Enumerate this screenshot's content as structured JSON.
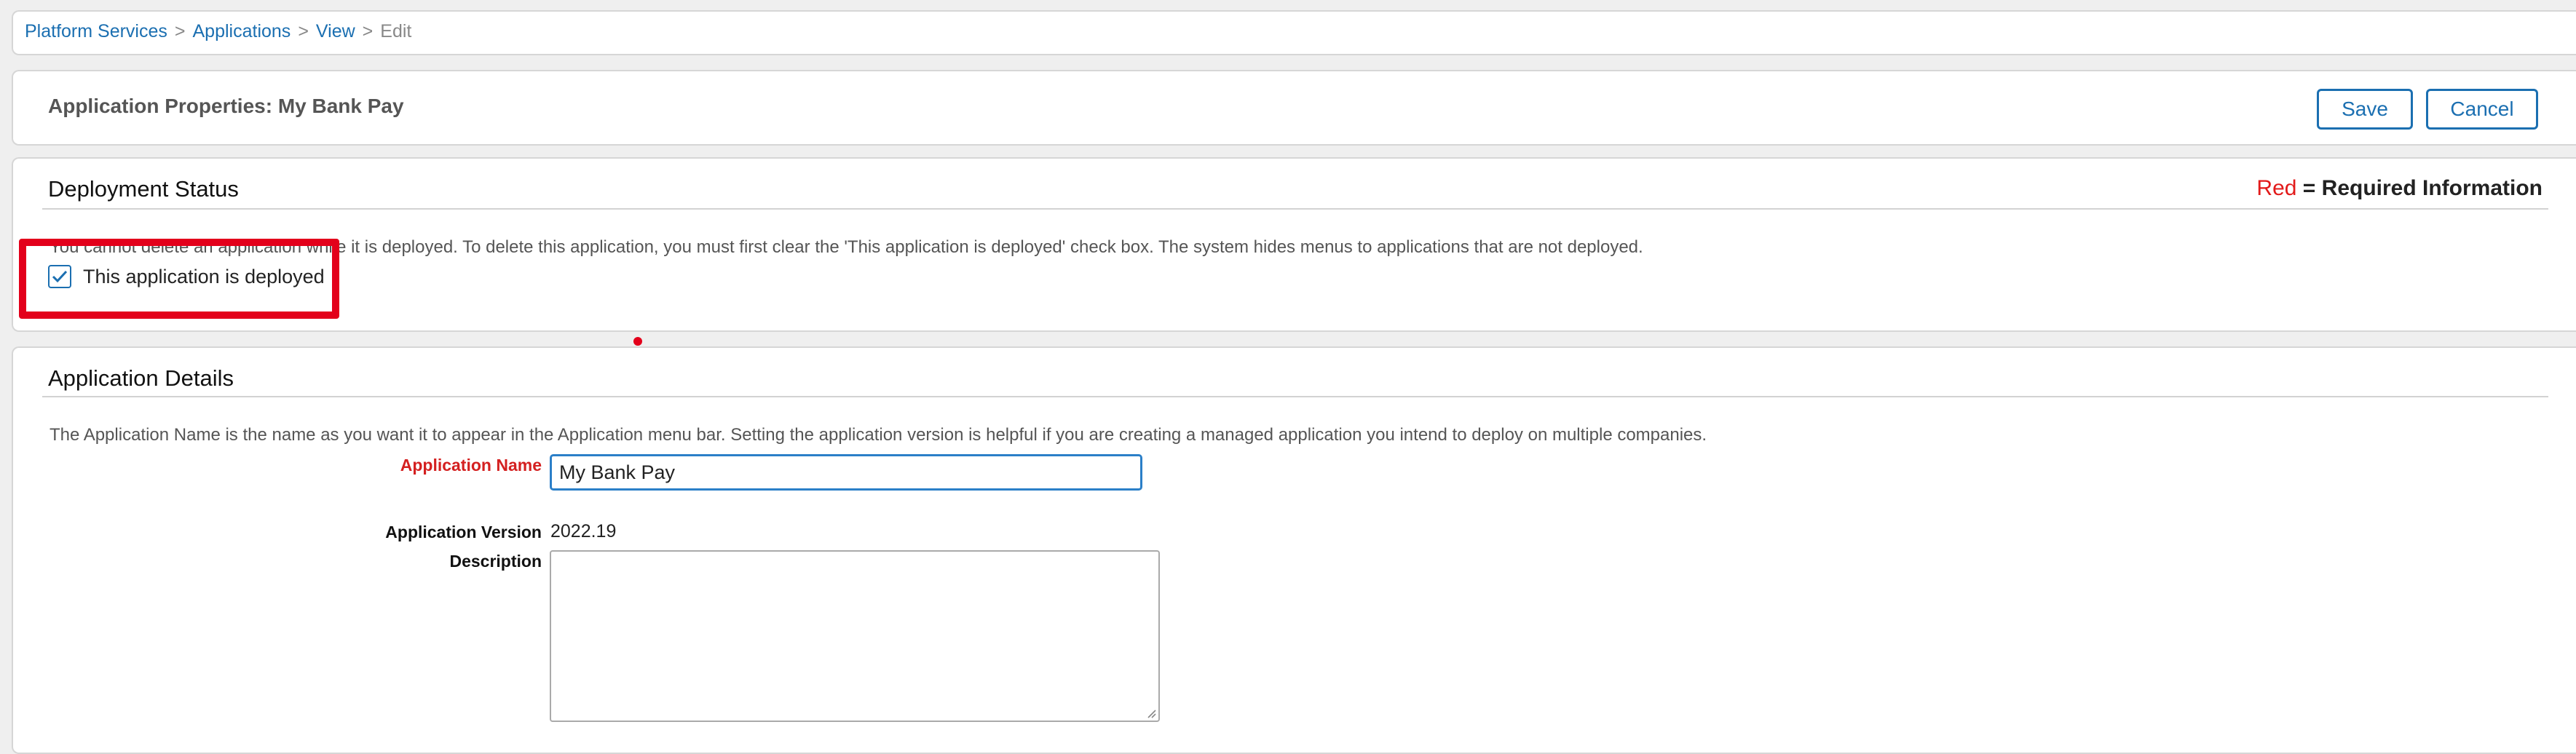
{
  "breadcrumb": {
    "items": [
      "Platform Services",
      "Applications",
      "View"
    ],
    "current": "Edit",
    "separator": ">"
  },
  "header": {
    "title": "Application Properties: My Bank Pay",
    "save_label": "Save",
    "cancel_label": "Cancel"
  },
  "deployment": {
    "title": "Deployment Status",
    "required_note_red": "Red",
    "required_note_rest": " = Required Information",
    "help": "You cannot delete an application while it is deployed. To delete this application, you must first clear the 'This application is deployed' check box. The system hides menus to applications that are not deployed.",
    "deployed_label": "This application is deployed",
    "deployed_checked": true
  },
  "details": {
    "title": "Application Details",
    "help": "The Application Name is the name as you want it to appear in the Application menu bar. Setting the application version is helpful if you are creating a managed application you intend to deploy on multiple companies.",
    "name_label": "Application Name",
    "name_value": "My Bank Pay",
    "version_label": "Application Version",
    "version_value": "2022.19",
    "description_label": "Description",
    "description_value": ""
  },
  "colors": {
    "link": "#1b6fb1",
    "required": "#d42020",
    "highlight": "#e3001b"
  }
}
